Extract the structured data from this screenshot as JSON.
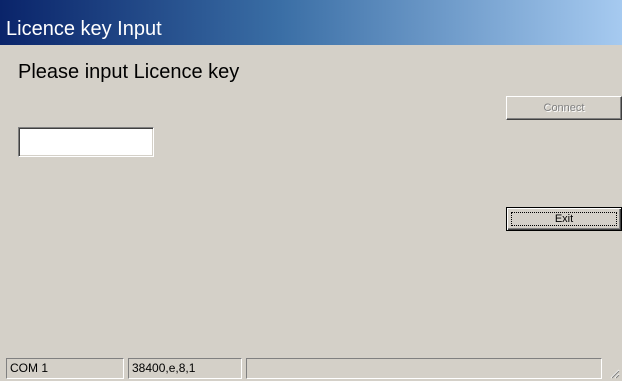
{
  "window": {
    "title": "Licence key Input"
  },
  "form": {
    "prompt": "Please input Licence key",
    "licence_key_value": "",
    "connect_label": "Connect",
    "connect_enabled": false,
    "exit_label": "Exit"
  },
  "statusbar": {
    "port": "COM 1",
    "settings": "38400,e,8,1",
    "message": ""
  }
}
